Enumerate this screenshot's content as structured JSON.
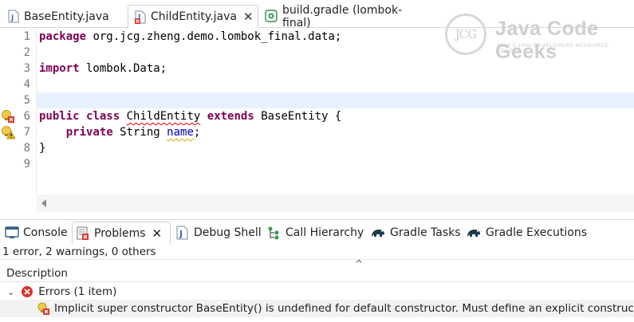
{
  "editor_tabs": [
    {
      "label": "BaseEntity.java",
      "active": false
    },
    {
      "label": "ChildEntity.java",
      "active": true,
      "close": "✕"
    },
    {
      "label": "build.gradle (lombok-final)",
      "active": false
    }
  ],
  "code_lines": [
    {
      "n": "1",
      "tokens": [
        {
          "t": "package",
          "c": "kw"
        },
        {
          "t": " org.jcg.zheng.demo.lombok_final.data;",
          "c": ""
        }
      ]
    },
    {
      "n": "2",
      "tokens": []
    },
    {
      "n": "3",
      "tokens": [
        {
          "t": "import",
          "c": "kw"
        },
        {
          "t": " lombok.Data;",
          "c": ""
        }
      ]
    },
    {
      "n": "4",
      "tokens": []
    },
    {
      "n": "5",
      "tokens": [],
      "current": true
    },
    {
      "n": "6",
      "marker": "error",
      "tokens": [
        {
          "t": "public",
          "c": "kw"
        },
        {
          "t": " ",
          "c": ""
        },
        {
          "t": "class",
          "c": "kw"
        },
        {
          "t": " ",
          "c": ""
        },
        {
          "t": "ChildEntity",
          "c": "squig"
        },
        {
          "t": " ",
          "c": ""
        },
        {
          "t": "extends",
          "c": "kw"
        },
        {
          "t": " BaseEntity {",
          "c": ""
        }
      ]
    },
    {
      "n": "7",
      "marker": "warning",
      "tokens": [
        {
          "t": "    ",
          "c": ""
        },
        {
          "t": "private",
          "c": "kw"
        },
        {
          "t": " String ",
          "c": ""
        },
        {
          "t": "name",
          "c": "fld squig-y"
        },
        {
          "t": ";",
          "c": ""
        }
      ]
    },
    {
      "n": "8",
      "tokens": [
        {
          "t": "}",
          "c": ""
        }
      ]
    },
    {
      "n": "9",
      "tokens": []
    }
  ],
  "watermark": {
    "logo_text": "JCG",
    "title": "Java Code Geeks",
    "subtitle": "JAVA 2 JAVA DEVELOPERS RESOURCE CENTER"
  },
  "view_tabs": [
    {
      "label": "Console",
      "icon": "console-icon"
    },
    {
      "label": "Problems",
      "icon": "problems-icon",
      "active": true,
      "close": "✕"
    },
    {
      "label": "Debug Shell",
      "icon": "debug-shell-icon"
    },
    {
      "label": "Call Hierarchy",
      "icon": "call-hierarchy-icon"
    },
    {
      "label": "Gradle Tasks",
      "icon": "gradle-tasks-icon"
    },
    {
      "label": "Gradle Executions",
      "icon": "gradle-executions-icon"
    }
  ],
  "problems": {
    "summary": "1 error, 2 warnings, 0 others",
    "collapse_glyph": "^",
    "column_header": "Description",
    "group_twisty": "⌄",
    "group_label": "Errors (1 item)",
    "message": "Implicit super constructor BaseEntity() is undefined for default constructor. Must define an explicit constructor"
  },
  "colors": {
    "keyword": "#7f0055",
    "field": "#0000c0",
    "error": "#d9332e",
    "current_line": "#e8f2fe"
  }
}
